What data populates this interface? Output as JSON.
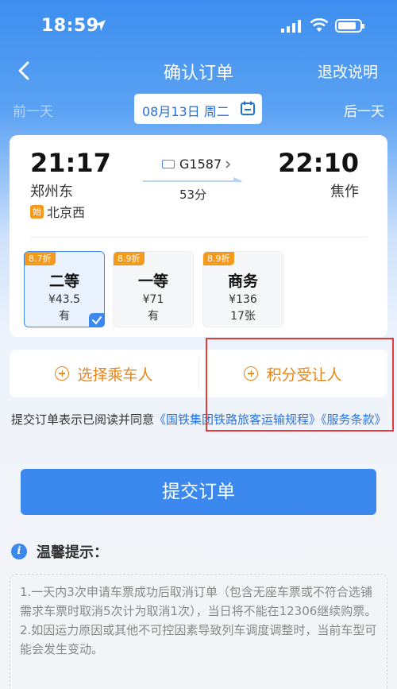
{
  "status_bar": {
    "time": "18:59"
  },
  "nav": {
    "title": "确认订单",
    "right_label": "退改说明"
  },
  "date_bar": {
    "prev": "前一天",
    "date": "08月13日 周二",
    "next": "后一天"
  },
  "train": {
    "number": "G1587",
    "depart_time": "21:17",
    "depart_station": "郑州东",
    "arrive_time": "22:10",
    "arrive_station": "焦作",
    "start_badge": "始",
    "origin_station": "北京西",
    "duration": "53分"
  },
  "seats": [
    {
      "discount": "8.7折",
      "class": "二等",
      "price": "¥43.5",
      "availability": "有",
      "selected": true
    },
    {
      "discount": "8.9折",
      "class": "一等",
      "price": "¥71",
      "availability": "有",
      "selected": false
    },
    {
      "discount": "8.9折",
      "class": "商务",
      "price": "¥136",
      "availability": "17张",
      "selected": false
    }
  ],
  "actions": {
    "select_passenger": "选择乘车人",
    "points_recipient": "积分受让人"
  },
  "agreement": {
    "prefix": "提交订单表示已阅读并同意",
    "link1": "《国铁集团铁路旅客运输规程》",
    "link2": "《服务条款》"
  },
  "submit_label": "提交订单",
  "tips": {
    "title": "温馨提示：",
    "line1": "1.一天内3次申请车票成功后取消订单（包含无座车票或不符合选铺需求车票时取消5次计为取消1次），当日将不能在12306继续购票。",
    "line2": "2.如因运力原因或其他不可控因素导致列车调度调整时，当前车型可能会发生变动。"
  },
  "colors": {
    "primary": "#3b88ef",
    "accent_orange": "#e8851b",
    "highlight_red": "#e23b3b"
  }
}
